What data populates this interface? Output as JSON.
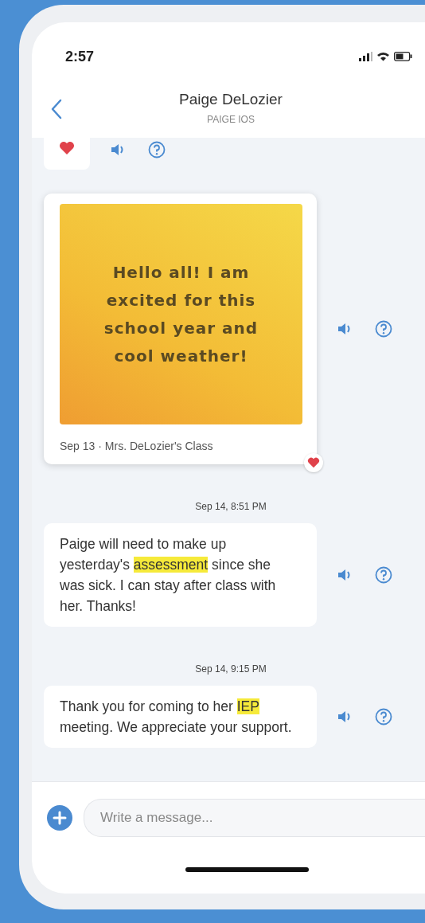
{
  "status_bar": {
    "time": "2:57"
  },
  "header": {
    "title": "Paige DeLozier",
    "subtitle": "PAIGE IOS"
  },
  "messages": [
    {
      "kind": "stub",
      "reacted": true
    },
    {
      "kind": "card",
      "image_text": "Hello all! I am excited for this school year and cool weather!",
      "caption": "Sep 13 · Mrs. DeLozier's Class",
      "reacted": true
    },
    {
      "kind": "text",
      "timestamp": "Sep 14, 8:51 PM",
      "parts": [
        {
          "text": "Paige will need to make up yesterday's ",
          "highlighted": false
        },
        {
          "text": "assessment",
          "highlighted": true
        },
        {
          "text": " since she was sick. I can stay after class with her. Thanks!",
          "highlighted": false
        }
      ]
    },
    {
      "kind": "text",
      "timestamp": "Sep 14, 9:15 PM",
      "parts": [
        {
          "text": "Thank you for coming to her ",
          "highlighted": false
        },
        {
          "text": "IEP",
          "highlighted": true
        },
        {
          "text": " meeting. We appreciate your support.",
          "highlighted": false
        }
      ]
    }
  ],
  "composer": {
    "placeholder": "Write a message..."
  }
}
